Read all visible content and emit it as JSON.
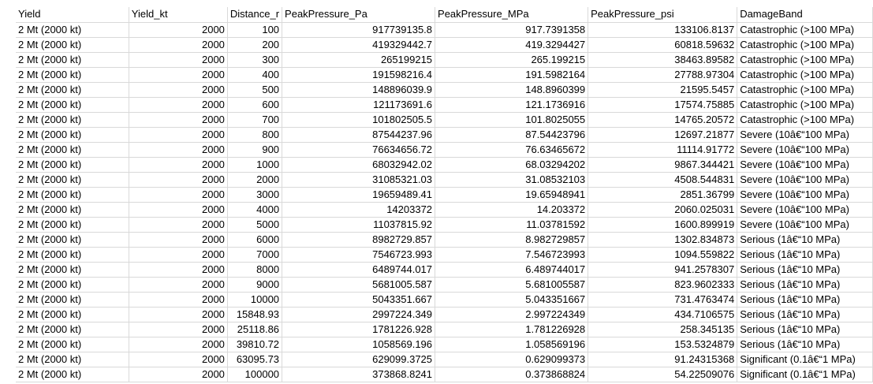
{
  "sheet": {
    "headers": [
      "Yield",
      "Yield_kt",
      "Distance_r",
      "PeakPressure_Pa",
      "PeakPressure_MPa",
      "PeakPressure_psi",
      "DamageBand"
    ],
    "rows": [
      [
        "2 Mt (2000 kt)",
        "2000",
        "100",
        "917739135.8",
        "917.7391358",
        "133106.8137",
        "Catastrophic (>100 MPa)"
      ],
      [
        "2 Mt (2000 kt)",
        "2000",
        "200",
        "419329442.7",
        "419.3294427",
        "60818.59632",
        "Catastrophic (>100 MPa)"
      ],
      [
        "2 Mt (2000 kt)",
        "2000",
        "300",
        "265199215",
        "265.199215",
        "38463.89582",
        "Catastrophic (>100 MPa)"
      ],
      [
        "2 Mt (2000 kt)",
        "2000",
        "400",
        "191598216.4",
        "191.5982164",
        "27788.97304",
        "Catastrophic (>100 MPa)"
      ],
      [
        "2 Mt (2000 kt)",
        "2000",
        "500",
        "148896039.9",
        "148.8960399",
        "21595.5457",
        "Catastrophic (>100 MPa)"
      ],
      [
        "2 Mt (2000 kt)",
        "2000",
        "600",
        "121173691.6",
        "121.1736916",
        "17574.75885",
        "Catastrophic (>100 MPa)"
      ],
      [
        "2 Mt (2000 kt)",
        "2000",
        "700",
        "101802505.5",
        "101.8025055",
        "14765.20572",
        "Catastrophic (>100 MPa)"
      ],
      [
        "2 Mt (2000 kt)",
        "2000",
        "800",
        "87544237.96",
        "87.54423796",
        "12697.21877",
        "Severe (10â€“100 MPa)"
      ],
      [
        "2 Mt (2000 kt)",
        "2000",
        "900",
        "76634656.72",
        "76.63465672",
        "11114.91772",
        "Severe (10â€“100 MPa)"
      ],
      [
        "2 Mt (2000 kt)",
        "2000",
        "1000",
        "68032942.02",
        "68.03294202",
        "9867.344421",
        "Severe (10â€“100 MPa)"
      ],
      [
        "2 Mt (2000 kt)",
        "2000",
        "2000",
        "31085321.03",
        "31.08532103",
        "4508.544831",
        "Severe (10â€“100 MPa)"
      ],
      [
        "2 Mt (2000 kt)",
        "2000",
        "3000",
        "19659489.41",
        "19.65948941",
        "2851.36799",
        "Severe (10â€“100 MPa)"
      ],
      [
        "2 Mt (2000 kt)",
        "2000",
        "4000",
        "14203372",
        "14.203372",
        "2060.025031",
        "Severe (10â€“100 MPa)"
      ],
      [
        "2 Mt (2000 kt)",
        "2000",
        "5000",
        "11037815.92",
        "11.03781592",
        "1600.899919",
        "Severe (10â€“100 MPa)"
      ],
      [
        "2 Mt (2000 kt)",
        "2000",
        "6000",
        "8982729.857",
        "8.982729857",
        "1302.834873",
        "Serious (1â€“10 MPa)"
      ],
      [
        "2 Mt (2000 kt)",
        "2000",
        "7000",
        "7546723.993",
        "7.546723993",
        "1094.559822",
        "Serious (1â€“10 MPa)"
      ],
      [
        "2 Mt (2000 kt)",
        "2000",
        "8000",
        "6489744.017",
        "6.489744017",
        "941.2578307",
        "Serious (1â€“10 MPa)"
      ],
      [
        "2 Mt (2000 kt)",
        "2000",
        "9000",
        "5681005.587",
        "5.681005587",
        "823.9602333",
        "Serious (1â€“10 MPa)"
      ],
      [
        "2 Mt (2000 kt)",
        "2000",
        "10000",
        "5043351.667",
        "5.043351667",
        "731.4763474",
        "Serious (1â€“10 MPa)"
      ],
      [
        "2 Mt (2000 kt)",
        "2000",
        "15848.93",
        "2997224.349",
        "2.997224349",
        "434.7106575",
        "Serious (1â€“10 MPa)"
      ],
      [
        "2 Mt (2000 kt)",
        "2000",
        "25118.86",
        "1781226.928",
        "1.781226928",
        "258.345135",
        "Serious (1â€“10 MPa)"
      ],
      [
        "2 Mt (2000 kt)",
        "2000",
        "39810.72",
        "1058569.196",
        "1.058569196",
        "153.5324879",
        "Serious (1â€“10 MPa)"
      ],
      [
        "2 Mt (2000 kt)",
        "2000",
        "63095.73",
        "629099.3725",
        "0.629099373",
        "91.24315368",
        "Significant (0.1â€“1 MPa)"
      ],
      [
        "2 Mt (2000 kt)",
        "2000",
        "100000",
        "373868.8241",
        "0.373868824",
        "54.22509076",
        "Significant (0.1â€“1 MPa)"
      ]
    ]
  }
}
